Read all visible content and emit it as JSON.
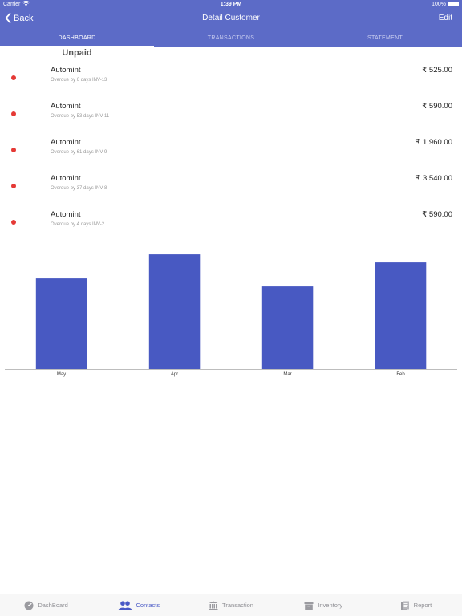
{
  "status_bar": {
    "carrier": "Carrier",
    "time": "1:39 PM",
    "battery": "100%"
  },
  "nav": {
    "back_label": "Back",
    "title": "Detail Customer",
    "edit_label": "Edit"
  },
  "tabs": [
    {
      "label": "DASHBOARD",
      "active": true
    },
    {
      "label": "TRANSACTIONS",
      "active": false
    },
    {
      "label": "STATEMENT",
      "active": false
    }
  ],
  "section_title": "Unpaid",
  "invoices": [
    {
      "name": "Automint",
      "detail": "Overdue by 6 days INV-13",
      "amount": "₹ 525.00"
    },
    {
      "name": "Automint",
      "detail": "Overdue by 53 days INV-11",
      "amount": "₹ 590.00"
    },
    {
      "name": "Automint",
      "detail": "Overdue by 61 days INV-9",
      "amount": "₹ 1,960.00"
    },
    {
      "name": "Automint",
      "detail": "Overdue by 37 days INV-8",
      "amount": "₹ 3,540.00"
    },
    {
      "name": "Automint",
      "detail": "Overdue by 4 days INV-2",
      "amount": "₹ 590.00"
    }
  ],
  "colors": {
    "primary": "#5c6bc7",
    "bar": "#4859c2",
    "overdue_dot": "#e53935",
    "active_tab": "#4a5ac6"
  },
  "chart_data": {
    "type": "bar",
    "categories": [
      "May",
      "Apr",
      "Mar",
      "Feb"
    ],
    "values": [
      79,
      100,
      72,
      93
    ],
    "ylim": [
      0,
      105
    ],
    "grid": false,
    "title": "",
    "xlabel": "",
    "ylabel": ""
  },
  "tabbar": [
    {
      "label": "DashBoard",
      "icon": "dashboard-icon",
      "active": false
    },
    {
      "label": "Contacts",
      "icon": "contacts-icon",
      "active": true
    },
    {
      "label": "Transaction",
      "icon": "bank-icon",
      "active": false
    },
    {
      "label": "Inventory",
      "icon": "archive-box-icon",
      "active": false
    },
    {
      "label": "Report",
      "icon": "report-icon",
      "active": false
    }
  ]
}
